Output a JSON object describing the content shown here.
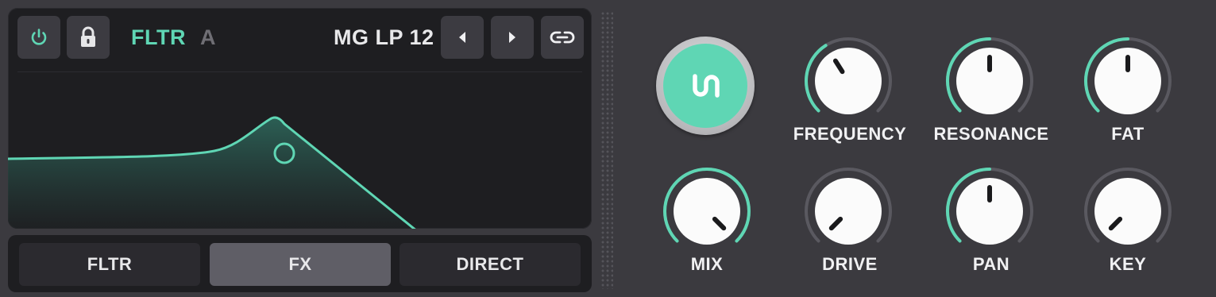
{
  "filter": {
    "title": "FLTR",
    "slot": "A",
    "preset": "MG LP 12",
    "power_icon": "power-icon",
    "lock_icon": "lock-icon",
    "prev_icon": "chevron-left-icon",
    "next_icon": "chevron-right-icon",
    "link_icon": "link-icon"
  },
  "routing": {
    "buttons": [
      {
        "label": "FLTR",
        "active": false
      },
      {
        "label": "FX",
        "active": true
      },
      {
        "label": "DIRECT",
        "active": false
      }
    ]
  },
  "unison": {
    "icon": "unison-icon",
    "color": "#5fd6b4"
  },
  "knobs": {
    "frequency": {
      "label": "FREQUENCY",
      "value": 0.38
    },
    "resonance": {
      "label": "RESONANCE",
      "value": 0.5
    },
    "fat": {
      "label": "FAT",
      "value": 0.5
    },
    "mix": {
      "label": "MIX",
      "value": 1.0
    },
    "drive": {
      "label": "DRIVE",
      "value": 0.0
    },
    "pan": {
      "label": "PAN",
      "value": 0.5
    },
    "key": {
      "label": "KEY",
      "value": 0.0
    }
  },
  "colors": {
    "accent": "#5fd6b4",
    "background": "#3b3a3f",
    "panel": "#1e1e21",
    "knob_track": "#5a5960",
    "text": "#f1f1f3"
  }
}
